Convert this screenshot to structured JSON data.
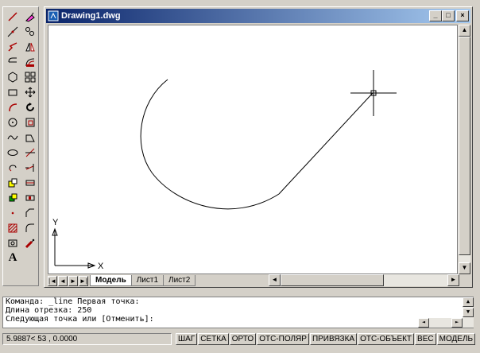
{
  "window": {
    "title": "Drawing1.dwg",
    "buttons": {
      "minimize": "_",
      "maximize": "□",
      "close": "×"
    }
  },
  "toolbars": {
    "draw": [
      "line",
      "construction-line",
      "polyline",
      "polygon",
      "rectangle",
      "arc",
      "circle",
      "spline",
      "ellipse",
      "ellipse-arc",
      "insert-block",
      "make-block",
      "point",
      "hatch",
      "region",
      "multiline-text"
    ],
    "modify": [
      "erase",
      "copy",
      "mirror",
      "offset",
      "array",
      "move",
      "rotate",
      "scale",
      "stretch",
      "trim",
      "extend",
      "break-at-point",
      "break",
      "chamfer",
      "fillet",
      "explode"
    ],
    "multiline_text_glyph": "A"
  },
  "canvas": {
    "ucs": {
      "x_label": "X",
      "y_label": "Y"
    }
  },
  "tabs": [
    {
      "label": "Модель",
      "active": true
    },
    {
      "label": "Лист1",
      "active": false
    },
    {
      "label": "Лист2",
      "active": false
    }
  ],
  "command": {
    "lines": [
      "Команда: _line Первая точка:",
      "Длина отрезка: 250",
      "Следующая точка или [Отменить]:"
    ]
  },
  "statusbar": {
    "coords": "5.9887<  53     , 0.0000",
    "buttons": [
      "ШАГ",
      "СЕТКА",
      "ОРТО",
      "ОТС-ПОЛЯР",
      "ПРИВЯЗКА",
      "ОТС-ОБЪЕКТ",
      "ВЕС",
      "МОДЕЛЬ"
    ]
  },
  "colors": {
    "titlebar_start": "#0a246a",
    "titlebar_end": "#a6caf0",
    "face": "#d4d0c8"
  }
}
